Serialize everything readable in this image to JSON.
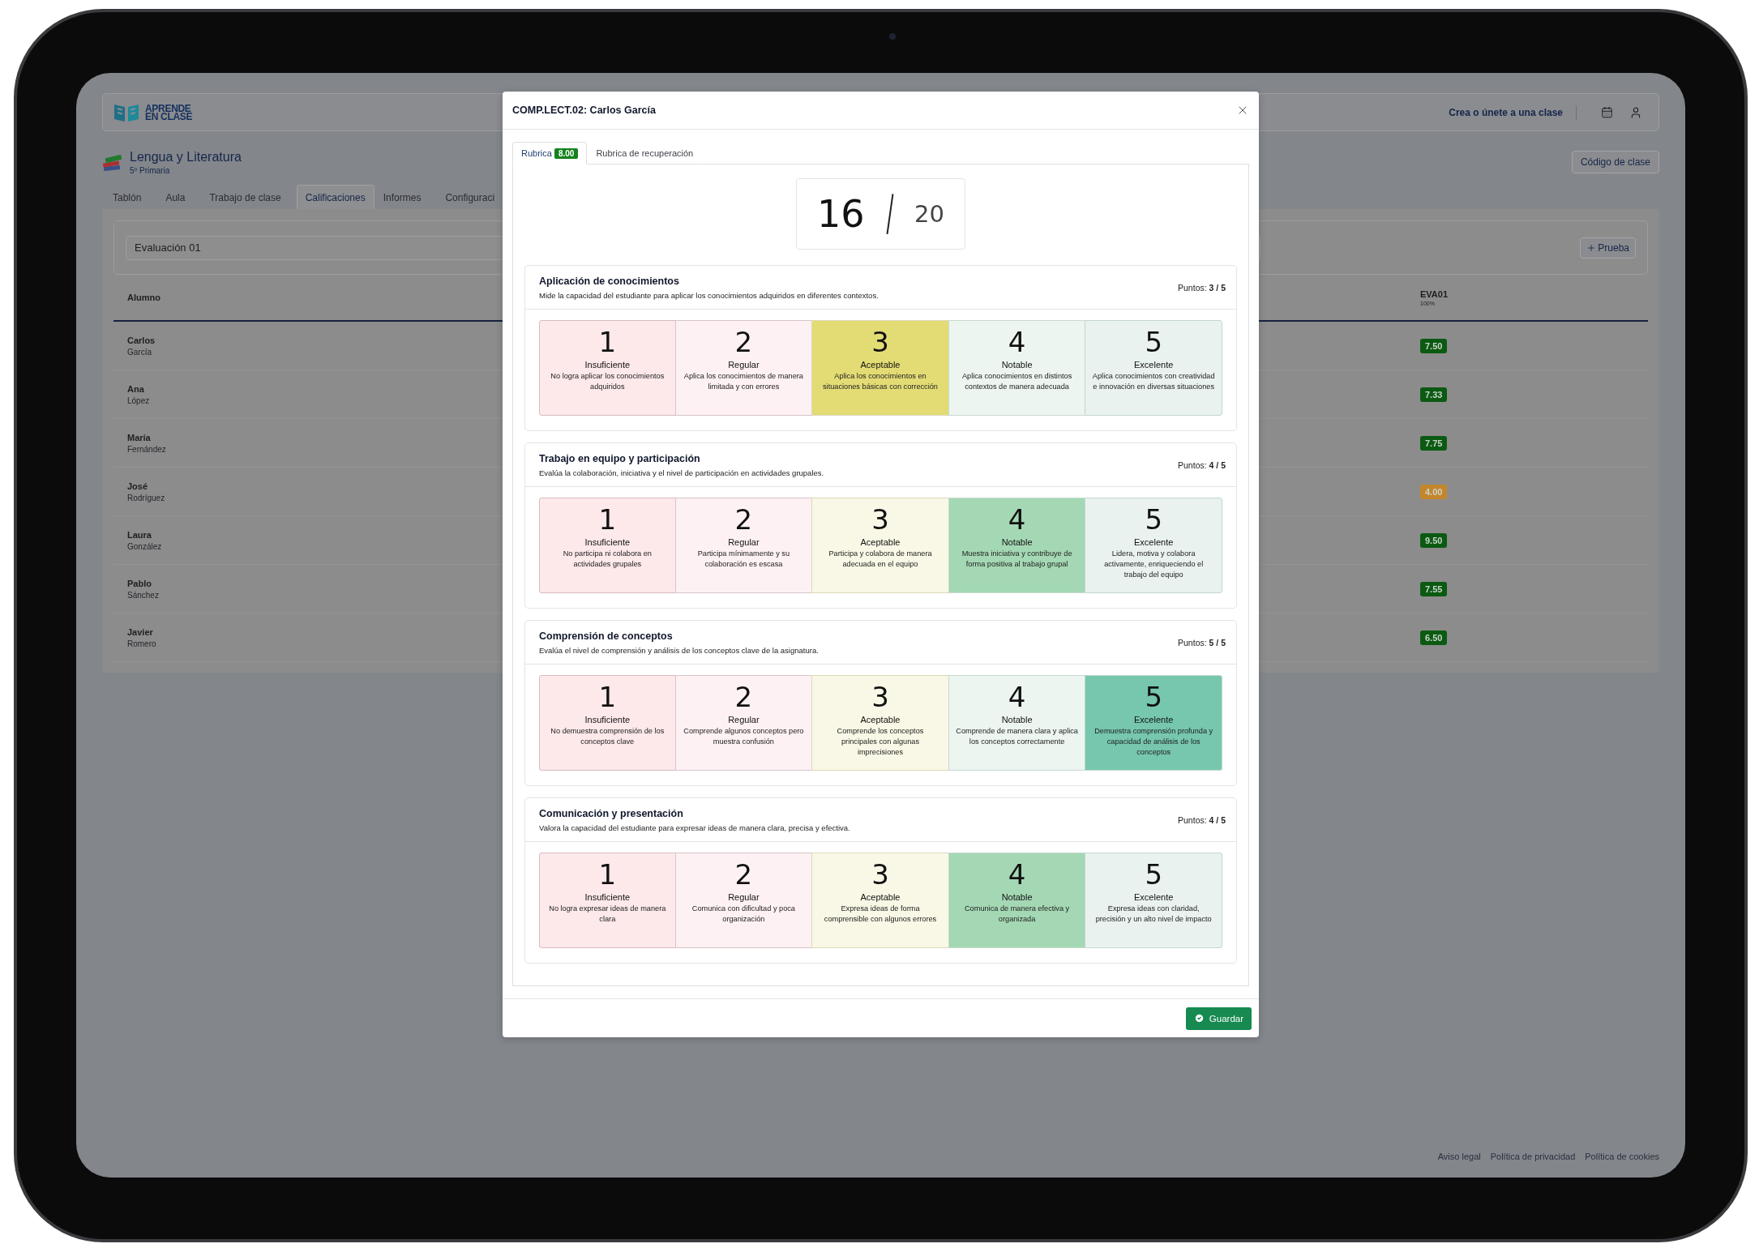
{
  "app": {
    "logo": {
      "lines": [
        "APRENDE",
        "EN CLASE"
      ]
    },
    "header_link": "Crea o únete a una clase",
    "course": {
      "title": "Lengua y Literatura",
      "subtitle": "5º Primaria"
    },
    "class_code_button": "Código de clase",
    "tabs": [
      {
        "label": "Tablón",
        "selected": false
      },
      {
        "label": "Aula",
        "selected": false
      },
      {
        "label": "Trabajo de clase",
        "selected": false
      },
      {
        "label": "Calificaciones",
        "selected": true
      },
      {
        "label": "Informes",
        "selected": false
      },
      {
        "label": "Configuraci",
        "selected": false
      }
    ],
    "filter": {
      "value": "Evaluación 01",
      "add_button": "Prueba"
    },
    "table": {
      "student_header": "Alumno",
      "grade_header": "EVA01",
      "grade_subheader": "100%",
      "rows": [
        {
          "first_name": "Carlos",
          "last_name": "García",
          "grade": "7.50",
          "color": "#0b5a12"
        },
        {
          "first_name": "Ana",
          "last_name": "López",
          "grade": "7.33",
          "color": "#0b5a12"
        },
        {
          "first_name": "María",
          "last_name": "Fernández",
          "grade": "7.75",
          "color": "#0b5a12"
        },
        {
          "first_name": "José",
          "last_name": "Rodríguez",
          "grade": "4.00",
          "color": "#c4862c"
        },
        {
          "first_name": "Laura",
          "last_name": "González",
          "grade": "9.50",
          "color": "#0b5a12"
        },
        {
          "first_name": "Pablo",
          "last_name": "Sánchez",
          "grade": "7.55",
          "color": "#0b5a12"
        },
        {
          "first_name": "Javier",
          "last_name": "Romero",
          "grade": "6.50",
          "color": "#0b5a12"
        }
      ]
    },
    "footer_links": [
      "Aviso legal",
      "Política de privacidad",
      "Política de cookies"
    ]
  },
  "modal": {
    "title": "COMP.LECT.02: Carlos García",
    "tabs": [
      {
        "label": "Rubrica",
        "badge": "8.00",
        "selected": true
      },
      {
        "label": "Rubrica de recuperación",
        "selected": false
      }
    ],
    "score": {
      "value": "16",
      "total": "20"
    },
    "criteria": [
      {
        "title": "Aplicación de conocimientos",
        "description": "Mide la capacidad del estudiante para aplicar los conocimientos adquiridos en diferentes contextos.",
        "points": "Puntos: **3 / 5**",
        "levels": [
          {
            "number": "1",
            "label": "Insuficiente",
            "description": "No logra aplicar los conocimientos adquiridos",
            "selected": false
          },
          {
            "number": "2",
            "label": "Regular",
            "description": "Aplica los conocimientos de manera limitada y con errores",
            "selected": false
          },
          {
            "number": "3",
            "label": "Aceptable",
            "description": "Aplica los conocimientos en situaciones básicas con corrección",
            "selected": true
          },
          {
            "number": "4",
            "label": "Notable",
            "description": "Aplica conocimientos en distintos contextos de manera adecuada",
            "selected": false
          },
          {
            "number": "5",
            "label": "Excelente",
            "description": "Aplica conocimientos con creatividad e innovación en diversas situaciones",
            "selected": false
          }
        ]
      },
      {
        "title": "Trabajo en equipo y participación",
        "description": "Evalúa la colaboración, iniciativa y el nivel de participación en actividades grupales.",
        "points": "Puntos: **4 / 5**",
        "levels": [
          {
            "number": "1",
            "label": "Insuficiente",
            "description": "No participa ni colabora en actividades grupales",
            "selected": false
          },
          {
            "number": "2",
            "label": "Regular",
            "description": "Participa mínimamente y su colaboración es escasa",
            "selected": false
          },
          {
            "number": "3",
            "label": "Aceptable",
            "description": "Participa y colabora de manera adecuada en el equipo",
            "selected": false
          },
          {
            "number": "4",
            "label": "Notable",
            "description": "Muestra iniciativa y contribuye de forma positiva al trabajo grupal",
            "selected": true
          },
          {
            "number": "5",
            "label": "Excelente",
            "description": "Lidera, motiva y colabora activamente, enriqueciendo el trabajo del equipo",
            "selected": false
          }
        ]
      },
      {
        "title": "Comprensión de conceptos",
        "description": "Evalúa el nivel de comprensión y análisis de los conceptos clave de la asignatura.",
        "points": "Puntos: **5 / 5**",
        "levels": [
          {
            "number": "1",
            "label": "Insuficiente",
            "description": "No demuestra comprensión de los conceptos clave",
            "selected": false
          },
          {
            "number": "2",
            "label": "Regular",
            "description": "Comprende algunos conceptos pero muestra confusión",
            "selected": false
          },
          {
            "number": "3",
            "label": "Aceptable",
            "description": "Comprende los conceptos principales con algunas imprecisiones",
            "selected": false
          },
          {
            "number": "4",
            "label": "Notable",
            "description": "Comprende de manera clara y aplica los conceptos correctamente",
            "selected": false
          },
          {
            "number": "5",
            "label": "Excelente",
            "description": "Demuestra comprensión profunda y capacidad de análisis de los conceptos",
            "selected": true
          }
        ]
      },
      {
        "title": "Comunicación y presentación",
        "description": "Valora la capacidad del estudiante para expresar ideas de manera clara, precisa y efectiva.",
        "points": "Puntos: **4 / 5**",
        "levels": [
          {
            "number": "1",
            "label": "Insuficiente",
            "description": "No logra expresar ideas de manera clara",
            "selected": false
          },
          {
            "number": "2",
            "label": "Regular",
            "description": "Comunica con dificultad y poca organización",
            "selected": false
          },
          {
            "number": "3",
            "label": "Aceptable",
            "description": "Expresa ideas de forma comprensible con algunos errores",
            "selected": false
          },
          {
            "number": "4",
            "label": "Notable",
            "description": "Comunica de manera efectiva y organizada",
            "selected": true
          },
          {
            "number": "5",
            "label": "Excelente",
            "description": "Expresa ideas con claridad, precisión y un alto nivel de impacto",
            "selected": false
          }
        ]
      }
    ],
    "save_button": "Guardar"
  }
}
